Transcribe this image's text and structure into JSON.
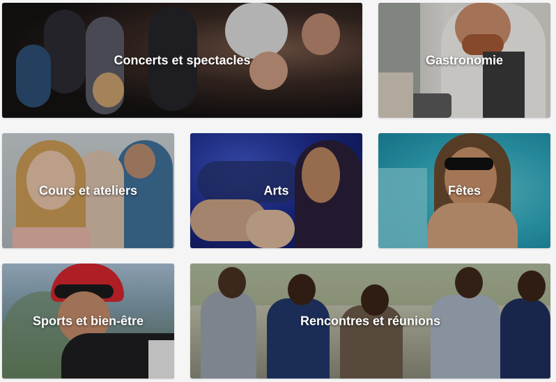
{
  "categories": [
    {
      "id": "concerts",
      "label": "Concerts et spectacles"
    },
    {
      "id": "gastronomie",
      "label": "Gastronomie"
    },
    {
      "id": "cours",
      "label": "Cours et ateliers"
    },
    {
      "id": "arts",
      "label": "Arts"
    },
    {
      "id": "fetes",
      "label": "Fêtes"
    },
    {
      "id": "sports",
      "label": "Sports et bien-être"
    },
    {
      "id": "rencontres",
      "label": "Rencontres et réunions"
    }
  ]
}
